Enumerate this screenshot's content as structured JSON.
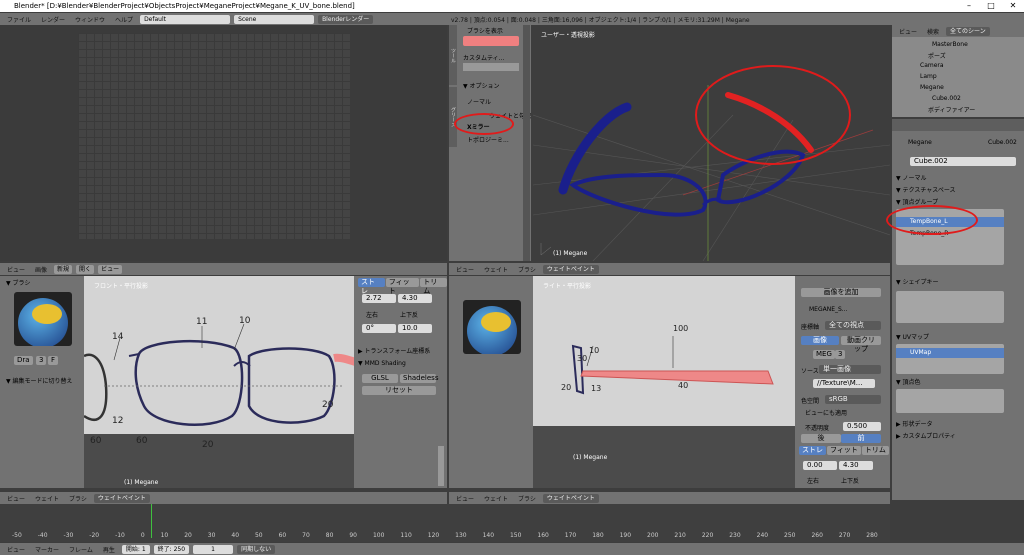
{
  "window": {
    "title": "Blender* [D:¥Blender¥BlenderProject¥ObjectsProject¥MeganeProject¥Megane_K_UV_bone.blend]",
    "min": "–",
    "max": "□",
    "close": "✕"
  },
  "top_menu": [
    "ファイル",
    "レンダー",
    "ウィンドウ",
    "ヘルプ"
  ],
  "layout_dd": "Default",
  "scene_dd": "Scene",
  "engine_dd": "Blenderレンダー",
  "info_stats": "v2.78 | 頂点:0.054 | 面:0.048 | 三角面:16,096 | オブジェクト:1/4 | ランプ:0/1 | メモリ:31.29M | Megane",
  "paint_tools": {
    "show_brush": "ブラシを表示",
    "custom": "カスタムティ...",
    "options": "▼ オプション",
    "normal": "ノーマル",
    "mirror": "Xミラー",
    "topology": "トポロジーミ...",
    "unified": "ウェイトと勾配"
  },
  "view3d_top": {
    "label": "ユーザー・透視投影",
    "obj": "(1) Megane"
  },
  "uv_header": {
    "items": [
      "ビュー",
      "画像"
    ],
    "new": "新規",
    "open": "開く",
    "view": "ビュー"
  },
  "uv_left": {
    "brush": "▼ ブラシ",
    "dra": "Dra",
    "num": "3",
    "f": "F",
    "edit_mode": "▼ 編集モードに切り替え"
  },
  "front_view": {
    "label": "フロント・平行投影",
    "obj": "(1) Megane",
    "n14": "14",
    "n11": "11",
    "n10": "10",
    "n12": "12",
    "n60a": "60",
    "n60b": "60",
    "n20": "20",
    "n20b": "20"
  },
  "front_props": {
    "tabs": [
      "ストレ",
      "フィット",
      "トリム"
    ],
    "v1": "2.72",
    "v2": "4.30",
    "cb1": "左右",
    "cb2": "上下反",
    "v3": "0°",
    "v4": "10.0",
    "transform": "▶ トランスフォーム座標系",
    "mmd": "▼ MMD Shading",
    "glsl": "GLSL",
    "shadeless": "Shadeless",
    "reset": "リセット"
  },
  "side_view": {
    "label": "ライト・平行投影",
    "obj": "(1) Megane",
    "n100": "100",
    "n10": "10",
    "n30": "30",
    "n40": "40",
    "n13": "13",
    "n20": "20"
  },
  "side_props": {
    "add_image": "画像を追加",
    "img_name": "MEGANE_S...",
    "axis": "座標軸",
    "axis_val": "全ての視点",
    "tab_img": "画像",
    "tab_clip": "動画クリップ",
    "img_short": "MEG",
    "num": "3",
    "src": "ソース",
    "src_val": "単一画像",
    "path": "//Texture\\M...",
    "colorspace": "色空間",
    "colorspace_val": "sRGB",
    "view_apply": "ビューにも適用",
    "opacity": "不透明度",
    "opacity_val": "0.500",
    "back": "後",
    "front": "前",
    "tabs": [
      "ストレ",
      "フィット",
      "トリム"
    ],
    "v1": "0.00",
    "v2": "4.30",
    "cb1": "左右",
    "cb2": "上下反"
  },
  "bottom_hdr": {
    "items": [
      "ビュー",
      "ウェイト",
      "ブラシ"
    ],
    "mode": "ウェイトペイント"
  },
  "view3d_hdr": {
    "items": [
      "ビュー",
      "ウェイト",
      "ブラシ"
    ],
    "mode": "ウェイトペイント"
  },
  "outliner": {
    "hdr_items": [
      "ビュー",
      "検索"
    ],
    "scene": "全てのシーン",
    "rows": [
      "MasterBone",
      "ポーズ",
      "Camera",
      "Lamp",
      "Megane",
      "Cube.002",
      "ボディファイアー"
    ]
  },
  "properties": {
    "crumb1": "Megane",
    "crumb2": "Cube.002",
    "name_field": "Cube.002",
    "normal": "▼ ノーマル",
    "texspace": "▼ テクスチャスペース",
    "vgroups": "▼ 頂点グループ",
    "vg1": "TempBone_L",
    "vg2": "TempBone_R",
    "shapekeys": "▼ シェイプキー",
    "uvmaps": "▼ UVマップ",
    "uvmap1": "UVMap",
    "vcolors": "▼ 頂点色",
    "geodata": "▶ 形状データ",
    "custom": "▶ カスタムプロパティ"
  },
  "timeline": {
    "ticks": [
      "-50",
      "-40",
      "-30",
      "-20",
      "-10",
      "0",
      "10",
      "20",
      "30",
      "40",
      "50",
      "60",
      "70",
      "80",
      "90",
      "100",
      "110",
      "120",
      "130",
      "140",
      "150",
      "160",
      "170",
      "180",
      "190",
      "200",
      "210",
      "220",
      "230",
      "240",
      "250",
      "260",
      "270",
      "280"
    ],
    "menus": [
      "ビュー",
      "マーカー",
      "フレーム",
      "再生"
    ],
    "start_lbl": "開始:",
    "start": "1",
    "end_lbl": "終了:",
    "end": "250",
    "frame": "1",
    "sync": "同期しない"
  },
  "colors": {
    "accent": "#5680c2",
    "ellipse": "#e01b1b",
    "glasses_blue": "#1a1f8c",
    "temple_red": "#e22222"
  }
}
